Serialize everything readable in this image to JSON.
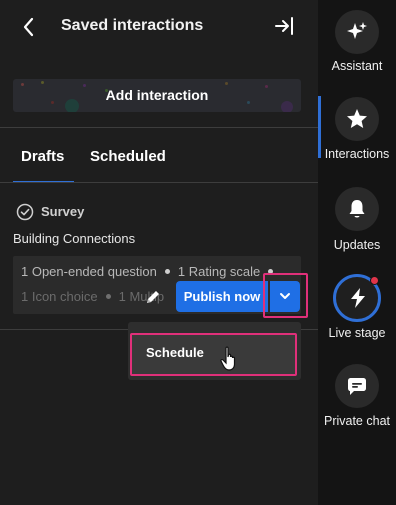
{
  "header": {
    "title": "Saved interactions",
    "back_icon": "chevron-left-icon",
    "exit_icon": "exit-arrow-icon"
  },
  "add_interaction": {
    "label": "Add interaction"
  },
  "tabs": [
    {
      "label": "Drafts",
      "active": true
    },
    {
      "label": "Scheduled",
      "active": false
    }
  ],
  "draft": {
    "type_label": "Survey",
    "name": "Building Connections",
    "details_line1": [
      "1 Open-ended question",
      "1 Rating scale"
    ],
    "details_line2": [
      "1 Icon choice",
      "1 Multip"
    ],
    "publish_label": "Publish now",
    "dropdown_items": [
      "Schedule"
    ]
  },
  "rail": [
    {
      "label": "Assistant",
      "icon": "sparkle-icon"
    },
    {
      "label": "Interactions",
      "icon": "star-icon"
    },
    {
      "label": "Updates",
      "icon": "bell-icon"
    },
    {
      "label": "Live stage",
      "icon": "lightning-icon"
    },
    {
      "label": "Private chat",
      "icon": "chat-bubble-icon"
    }
  ],
  "colors": {
    "accent": "#1f6fe5",
    "highlight": "#e0307a",
    "notification": "#e0354a"
  }
}
